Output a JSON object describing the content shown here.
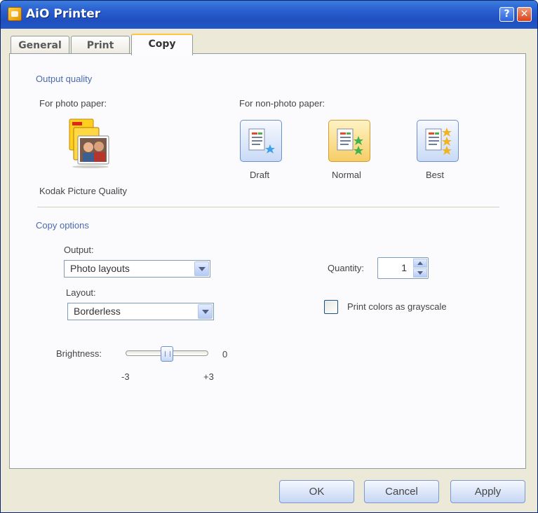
{
  "window": {
    "title": "AiO Printer",
    "help_glyph": "?",
    "close_glyph": "✕"
  },
  "tabs": [
    {
      "label": "General",
      "active": false
    },
    {
      "label": "Print",
      "active": false
    },
    {
      "label": "Copy",
      "active": true
    }
  ],
  "output_quality": {
    "heading": "Output quality",
    "photo_label": "For photo paper:",
    "photo_option_label": "Kodak Picture Quality",
    "photo_icon": "kodak-photo-icon",
    "nonphoto_label": "For non-photo paper:",
    "options": [
      {
        "label": "Draft",
        "icon": "draft-quality-icon",
        "selected": false
      },
      {
        "label": "Normal",
        "icon": "normal-quality-icon",
        "selected": true
      },
      {
        "label": "Best",
        "icon": "best-quality-icon",
        "selected": false
      }
    ]
  },
  "copy_options": {
    "heading": "Copy options",
    "output_label": "Output:",
    "output_value": "Photo layouts",
    "layout_label": "Layout:",
    "layout_value": "Borderless",
    "quantity_label": "Quantity:",
    "quantity_value": "1",
    "grayscale_label": "Print colors as grayscale",
    "grayscale_checked": false,
    "brightness_label": "Brightness:",
    "brightness_value": "0",
    "brightness_min": "-3",
    "brightness_max": "+3"
  },
  "buttons": {
    "ok": "OK",
    "cancel": "Cancel",
    "apply": "Apply"
  },
  "colors": {
    "titlebar": "#2a5fd0",
    "section_heading": "#4a6ab0",
    "selected_quality": "#f6cd66",
    "dialog_bg": "#ece9d8"
  }
}
